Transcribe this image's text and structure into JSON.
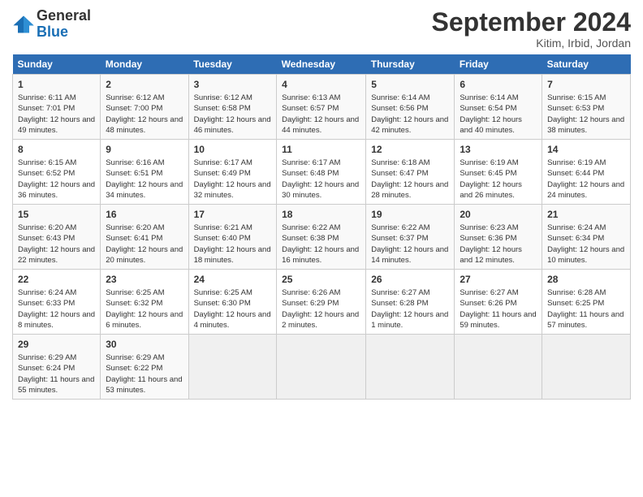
{
  "logo": {
    "general": "General",
    "blue": "Blue"
  },
  "header": {
    "month": "September 2024",
    "location": "Kitim, Irbid, Jordan"
  },
  "days_of_week": [
    "Sunday",
    "Monday",
    "Tuesday",
    "Wednesday",
    "Thursday",
    "Friday",
    "Saturday"
  ],
  "weeks": [
    [
      {
        "day": 1,
        "sunrise": "6:11 AM",
        "sunset": "7:01 PM",
        "daylight": "12 hours and 49 minutes."
      },
      {
        "day": 2,
        "sunrise": "6:12 AM",
        "sunset": "7:00 PM",
        "daylight": "12 hours and 48 minutes."
      },
      {
        "day": 3,
        "sunrise": "6:12 AM",
        "sunset": "6:58 PM",
        "daylight": "12 hours and 46 minutes."
      },
      {
        "day": 4,
        "sunrise": "6:13 AM",
        "sunset": "6:57 PM",
        "daylight": "12 hours and 44 minutes."
      },
      {
        "day": 5,
        "sunrise": "6:14 AM",
        "sunset": "6:56 PM",
        "daylight": "12 hours and 42 minutes."
      },
      {
        "day": 6,
        "sunrise": "6:14 AM",
        "sunset": "6:54 PM",
        "daylight": "12 hours and 40 minutes."
      },
      {
        "day": 7,
        "sunrise": "6:15 AM",
        "sunset": "6:53 PM",
        "daylight": "12 hours and 38 minutes."
      }
    ],
    [
      {
        "day": 8,
        "sunrise": "6:15 AM",
        "sunset": "6:52 PM",
        "daylight": "12 hours and 36 minutes."
      },
      {
        "day": 9,
        "sunrise": "6:16 AM",
        "sunset": "6:51 PM",
        "daylight": "12 hours and 34 minutes."
      },
      {
        "day": 10,
        "sunrise": "6:17 AM",
        "sunset": "6:49 PM",
        "daylight": "12 hours and 32 minutes."
      },
      {
        "day": 11,
        "sunrise": "6:17 AM",
        "sunset": "6:48 PM",
        "daylight": "12 hours and 30 minutes."
      },
      {
        "day": 12,
        "sunrise": "6:18 AM",
        "sunset": "6:47 PM",
        "daylight": "12 hours and 28 minutes."
      },
      {
        "day": 13,
        "sunrise": "6:19 AM",
        "sunset": "6:45 PM",
        "daylight": "12 hours and 26 minutes."
      },
      {
        "day": 14,
        "sunrise": "6:19 AM",
        "sunset": "6:44 PM",
        "daylight": "12 hours and 24 minutes."
      }
    ],
    [
      {
        "day": 15,
        "sunrise": "6:20 AM",
        "sunset": "6:43 PM",
        "daylight": "12 hours and 22 minutes."
      },
      {
        "day": 16,
        "sunrise": "6:20 AM",
        "sunset": "6:41 PM",
        "daylight": "12 hours and 20 minutes."
      },
      {
        "day": 17,
        "sunrise": "6:21 AM",
        "sunset": "6:40 PM",
        "daylight": "12 hours and 18 minutes."
      },
      {
        "day": 18,
        "sunrise": "6:22 AM",
        "sunset": "6:38 PM",
        "daylight": "12 hours and 16 minutes."
      },
      {
        "day": 19,
        "sunrise": "6:22 AM",
        "sunset": "6:37 PM",
        "daylight": "12 hours and 14 minutes."
      },
      {
        "day": 20,
        "sunrise": "6:23 AM",
        "sunset": "6:36 PM",
        "daylight": "12 hours and 12 minutes."
      },
      {
        "day": 21,
        "sunrise": "6:24 AM",
        "sunset": "6:34 PM",
        "daylight": "12 hours and 10 minutes."
      }
    ],
    [
      {
        "day": 22,
        "sunrise": "6:24 AM",
        "sunset": "6:33 PM",
        "daylight": "12 hours and 8 minutes."
      },
      {
        "day": 23,
        "sunrise": "6:25 AM",
        "sunset": "6:32 PM",
        "daylight": "12 hours and 6 minutes."
      },
      {
        "day": 24,
        "sunrise": "6:25 AM",
        "sunset": "6:30 PM",
        "daylight": "12 hours and 4 minutes."
      },
      {
        "day": 25,
        "sunrise": "6:26 AM",
        "sunset": "6:29 PM",
        "daylight": "12 hours and 2 minutes."
      },
      {
        "day": 26,
        "sunrise": "6:27 AM",
        "sunset": "6:28 PM",
        "daylight": "12 hours and 1 minute."
      },
      {
        "day": 27,
        "sunrise": "6:27 AM",
        "sunset": "6:26 PM",
        "daylight": "11 hours and 59 minutes."
      },
      {
        "day": 28,
        "sunrise": "6:28 AM",
        "sunset": "6:25 PM",
        "daylight": "11 hours and 57 minutes."
      }
    ],
    [
      {
        "day": 29,
        "sunrise": "6:29 AM",
        "sunset": "6:24 PM",
        "daylight": "11 hours and 55 minutes."
      },
      {
        "day": 30,
        "sunrise": "6:29 AM",
        "sunset": "6:22 PM",
        "daylight": "11 hours and 53 minutes."
      },
      null,
      null,
      null,
      null,
      null
    ]
  ]
}
